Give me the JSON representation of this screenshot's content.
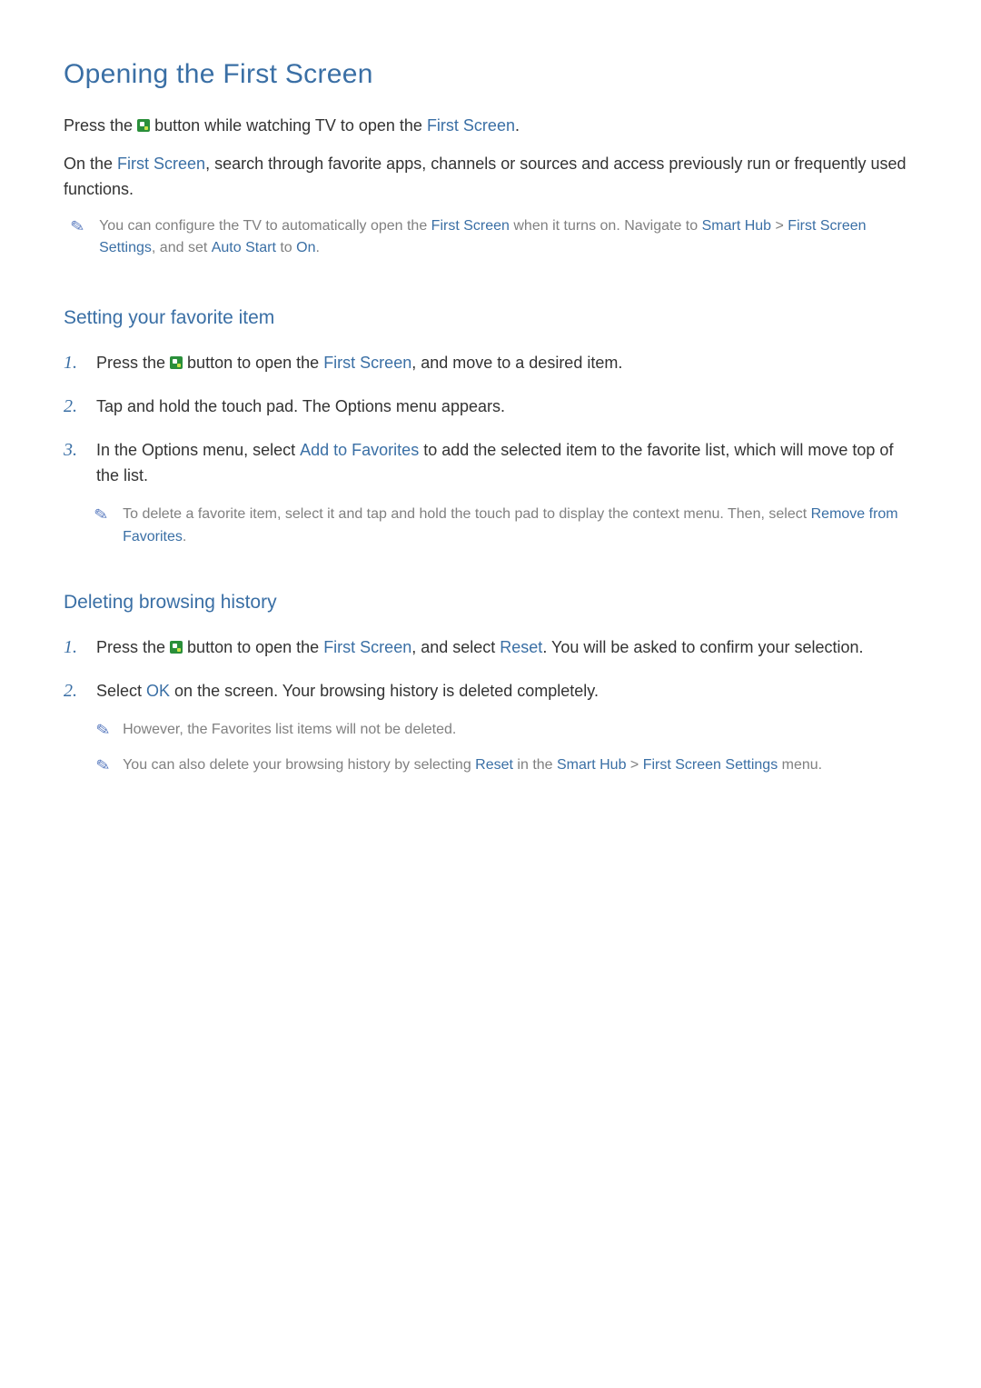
{
  "title": "Opening the First Screen",
  "intro": {
    "p1_a": "Press the ",
    "p1_b": " button while watching TV to open the ",
    "p1_first_screen": "First Screen",
    "p1_c": ".",
    "p2_a": "On the ",
    "p2_first_screen": "First Screen",
    "p2_b": ", search through favorite apps, channels or sources and access previously run or frequently used functions."
  },
  "note1": {
    "a": "You can configure the TV to automatically open the ",
    "first_screen": "First Screen",
    "b": " when it turns on. Navigate to ",
    "smart_hub": "Smart Hub",
    "sep": " > ",
    "first_screen_settings": "First Screen Settings",
    "c": ", and set ",
    "auto_start": "Auto Start",
    "d": " to ",
    "on": "On",
    "e": "."
  },
  "section_favorite": {
    "heading": "Setting your favorite item",
    "steps": [
      {
        "num": "1.",
        "a": "Press the ",
        "b": " button to open the ",
        "first_screen": "First Screen",
        "c": ", and move to a desired item."
      },
      {
        "num": "2.",
        "text": "Tap and hold the touch pad. The Options menu appears."
      },
      {
        "num": "3.",
        "a": "In the Options menu, select ",
        "add_fav": "Add to Favorites",
        "b": " to add the selected item to the favorite list, which will move top of the list."
      }
    ],
    "note": {
      "a": "To delete a favorite item, select it and tap and hold the touch pad to display the context menu. Then, select ",
      "remove": "Remove from Favorites",
      "b": "."
    }
  },
  "section_delete": {
    "heading": "Deleting browsing history",
    "steps": [
      {
        "num": "1.",
        "a": "Press the ",
        "b": " button to open the ",
        "first_screen": "First Screen",
        "c": ", and select ",
        "reset": "Reset",
        "d": ". You will be asked to confirm your selection."
      },
      {
        "num": "2.",
        "a": "Select ",
        "ok": "OK",
        "b": " on the screen. Your browsing history is deleted completely."
      }
    ],
    "note2": {
      "text": "However, the Favorites list items will not be deleted."
    },
    "note3": {
      "a": "You can also delete your browsing history by selecting ",
      "reset": "Reset",
      "b": " in the ",
      "smart_hub": "Smart Hub",
      "sep": " > ",
      "first_screen_settings": "First Screen Settings",
      "c": " menu."
    }
  }
}
